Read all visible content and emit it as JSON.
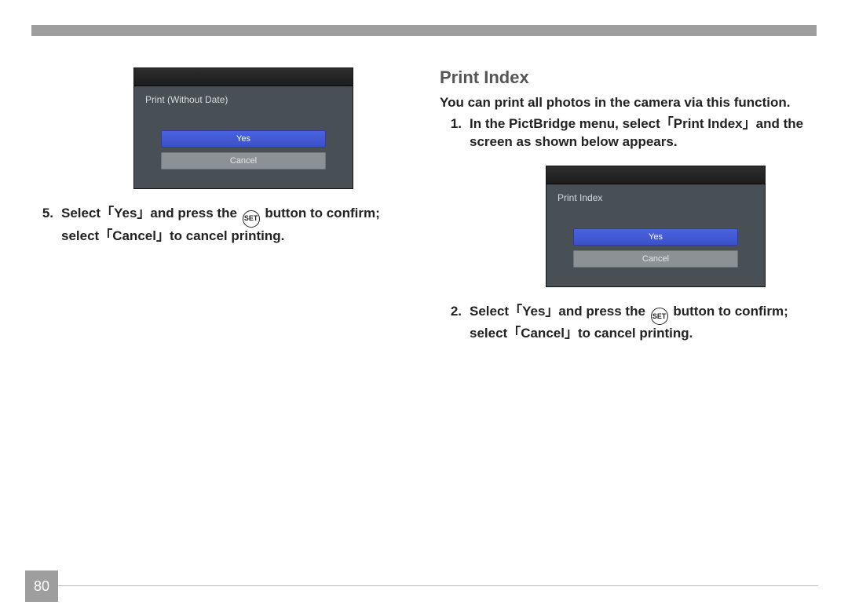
{
  "page_number": "80",
  "icons": {
    "set_label": "SET"
  },
  "left": {
    "dialog": {
      "title": "Print (Without Date)",
      "yes": "Yes",
      "cancel": "Cancel"
    },
    "step5": {
      "num": "5.",
      "t1": "Select「Yes」and press the ",
      "t2": " button to confirm; select「Cancel」to cancel printing."
    }
  },
  "right": {
    "heading": "Print Index",
    "intro": "You can print all photos in the camera via this function.",
    "step1": {
      "num": "1.",
      "text": "In the PictBridge menu, select「Print Index」and the screen as shown below appears."
    },
    "dialog": {
      "title": "Print Index",
      "yes": "Yes",
      "cancel": "Cancel"
    },
    "step2": {
      "num": "2.",
      "t1": "Select「Yes」and press the ",
      "t2": " button to confirm; select「Cancel」to cancel printing."
    }
  }
}
